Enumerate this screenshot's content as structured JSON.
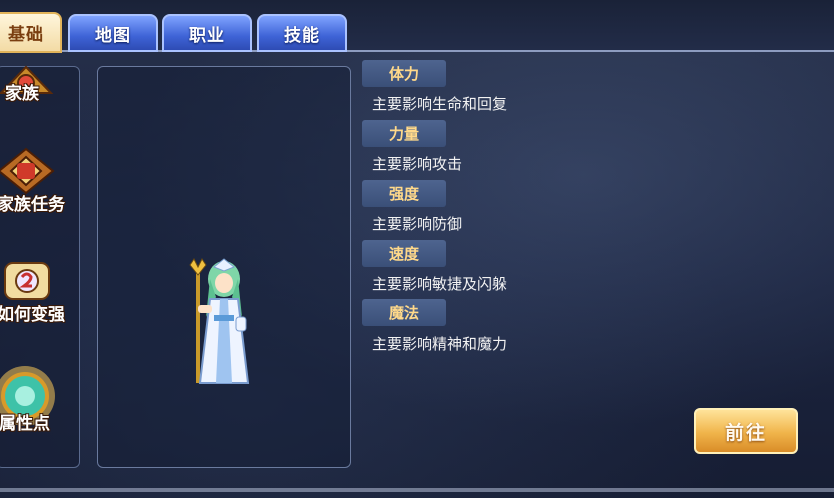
{
  "tabs": [
    {
      "label": "基础"
    },
    {
      "label": "地图"
    },
    {
      "label": "职业"
    },
    {
      "label": "技能"
    }
  ],
  "sidebar": {
    "items": [
      {
        "label": "家族",
        "icon": "family-emblem-icon"
      },
      {
        "label": "家族任务",
        "icon": "family-quest-icon"
      },
      {
        "label": "如何变强",
        "icon": "scroll-upgrade-icon"
      },
      {
        "label": "属性点",
        "icon": "attribute-orb-icon"
      }
    ]
  },
  "character": {
    "icon": "priestess-character-sprite"
  },
  "attributes": [
    {
      "name": "体力",
      "desc": "主要影响生命和回复"
    },
    {
      "name": "力量",
      "desc": "主要影响攻击"
    },
    {
      "name": "强度",
      "desc": "主要影响防御"
    },
    {
      "name": "速度",
      "desc": "主要影响敏捷及闪躲"
    },
    {
      "name": "魔法",
      "desc": "主要影响精神和魔力"
    }
  ],
  "actions": {
    "go_label": "前往"
  },
  "colors": {
    "accent_gold": "#f0b44a",
    "attr_label": "#ffd98a",
    "tab_blue": "#3e63d6"
  }
}
